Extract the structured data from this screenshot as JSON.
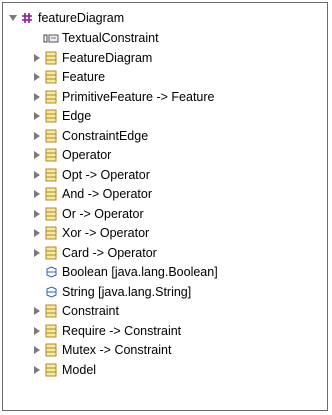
{
  "tree": {
    "root": {
      "label": "featureDiagram",
      "icon": "package-icon",
      "expanded": true
    },
    "items": [
      {
        "label": "TextualConstraint",
        "icon": "annotation-icon",
        "expandable": false
      },
      {
        "label": "FeatureDiagram",
        "icon": "eclass-icon",
        "expandable": true
      },
      {
        "label": "Feature",
        "icon": "eclass-icon",
        "expandable": true
      },
      {
        "label": "PrimitiveFeature -> Feature",
        "icon": "eclass-icon",
        "expandable": true
      },
      {
        "label": "Edge",
        "icon": "eclass-icon",
        "expandable": true
      },
      {
        "label": "ConstraintEdge",
        "icon": "eclass-icon",
        "expandable": true
      },
      {
        "label": "Operator",
        "icon": "eclass-icon",
        "expandable": true
      },
      {
        "label": "Opt -> Operator",
        "icon": "eclass-icon",
        "expandable": true
      },
      {
        "label": "And -> Operator",
        "icon": "eclass-icon",
        "expandable": true
      },
      {
        "label": "Or -> Operator",
        "icon": "eclass-icon",
        "expandable": true
      },
      {
        "label": "Xor -> Operator",
        "icon": "eclass-icon",
        "expandable": true
      },
      {
        "label": "Card -> Operator",
        "icon": "eclass-icon",
        "expandable": true
      },
      {
        "label": "Boolean [java.lang.Boolean]",
        "icon": "datatype-icon",
        "expandable": false
      },
      {
        "label": "String [java.lang.String]",
        "icon": "datatype-icon",
        "expandable": false
      },
      {
        "label": "Constraint",
        "icon": "eclass-icon",
        "expandable": true
      },
      {
        "label": "Require -> Constraint",
        "icon": "eclass-icon",
        "expandable": true
      },
      {
        "label": "Mutex -> Constraint",
        "icon": "eclass-icon",
        "expandable": true
      },
      {
        "label": "Model",
        "icon": "eclass-icon",
        "expandable": true
      }
    ]
  },
  "colors": {
    "class_fill": "#f6e9a8",
    "class_stroke": "#b08a1c",
    "package_color": "#8c1a9a",
    "datatype_color": "#2f62b0",
    "twistie": "#7a7a7a"
  }
}
